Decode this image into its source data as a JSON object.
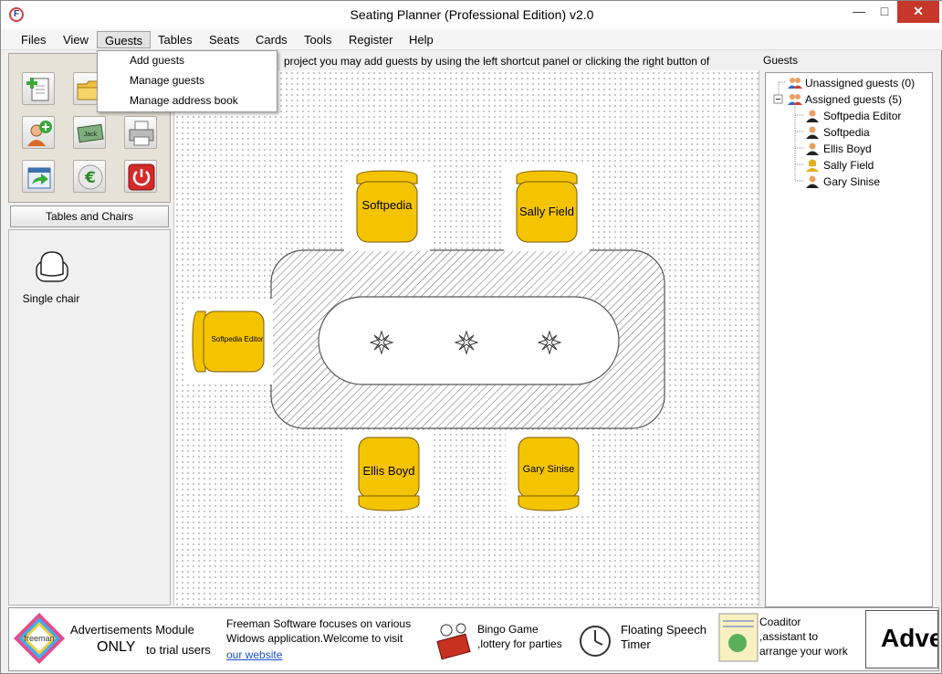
{
  "window": {
    "title": "Seating Planner (Professional Edition) v2.0",
    "app_icon": "F",
    "controls": {
      "minimize": "—",
      "maximize": "□",
      "close": "✕"
    }
  },
  "menubar": {
    "items": [
      "Files",
      "View",
      "Guests",
      "Tables",
      "Seats",
      "Cards",
      "Tools",
      "Register",
      "Help"
    ],
    "open_menu": "Guests"
  },
  "guests_menu": {
    "items": [
      "Add guests",
      "Manage guests",
      "Manage address book"
    ]
  },
  "toolbox": {
    "icons": [
      "new-project-icon",
      "open-folder-icon",
      "save-icon",
      "add-guest-icon",
      "name-card-icon",
      "printer-icon",
      "export-icon",
      "euro-icon",
      "power-icon"
    ],
    "name_card_label": "Jack"
  },
  "left_panel": {
    "section_button": "Tables and Chairs",
    "items": [
      {
        "label": "Single chair",
        "icon": "chair-icon"
      }
    ]
  },
  "hint": "project you may add guests by using the left shortcut panel or clicking the right button of",
  "seats": {
    "top_left": "Softpedia",
    "top_right": "Sally Field",
    "left": "Softpedia Editor",
    "bottom_left": "Ellis Boyd",
    "bottom_right": "Gary Sinise"
  },
  "guests_panel": {
    "title": "Guests",
    "groups": [
      {
        "label": "Unassigned guests (0)",
        "members": []
      },
      {
        "label": "Assigned guests (5)",
        "members": [
          "Softpedia Editor",
          "Softpedia",
          "Ellis Boyd",
          "Sally Field",
          "Gary Sinise"
        ]
      }
    ]
  },
  "ads": {
    "logo_text": "freeman",
    "module_title": "Advertisements Module",
    "module_sub_bold": "ONLY",
    "module_sub": "to trial users",
    "intro_line1": "Freeman Software focuses on various",
    "intro_line2": "Widows application.Welcome to visit",
    "link": "our website",
    "products": [
      {
        "line1": "Bingo Game",
        "line2": ",lottery for parties"
      },
      {
        "line1": "Floating Speech",
        "line2": "Timer"
      },
      {
        "line1": "Coaditor",
        "line2": ",assistant to",
        "line3": "arrange your work"
      }
    ],
    "big": "Adve"
  },
  "colors": {
    "chair_fill": "#f5c400",
    "chair_stroke": "#7a5c00",
    "close_button": "#c7372a",
    "link": "#1a4fc8"
  }
}
